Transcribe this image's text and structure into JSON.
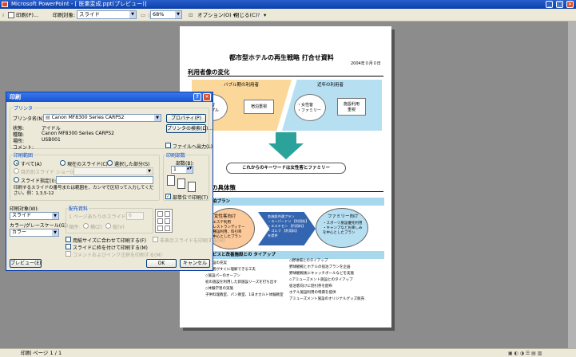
{
  "window": {
    "title": "Microsoft PowerPoint - [ 医業変成.ppt(プレビュー)]",
    "min": "_",
    "max": "□",
    "close": "✕"
  },
  "toolbar": {
    "print": "印刷(P)...",
    "print_target_label": "印刷対象:",
    "print_target_value": "スライド",
    "zoom": "68%",
    "options": "オプション(O) ▾",
    "close_preview": "閉じる(C)",
    "help": "▾"
  },
  "status": {
    "text": "印刷 ページ 1 / 1"
  },
  "slide": {
    "title": "都市型ホテルの再生戦略 打合せ資料",
    "date": "2004年０月０日",
    "section1": "利用者像の変化",
    "bubble_era": "バブル期の利用者",
    "recent_era": "近年の利用者",
    "bubble_users": "・出張客\n・カップル",
    "bubble_purpose": "宿泊重視",
    "recent_users": "・女性客\n・ファミリー",
    "recent_purpose": "施設利用\n重視",
    "keyword": "これからのキーワードは女性客とファミリー",
    "section2": "加のための具体策",
    "band1": "る宿泊プラン",
    "plan_female_title": "女性客向け",
    "plan_female_body": "・エステ利用\n・レストランディナー\n各種設利用、料引率\nを中心としたプラン",
    "plan_common": "各施設共通プラン\n・スーパードリ 【利用料】\n・エステセン 【利用料】\n・ゴルフ 【利用料】\nを提供",
    "plan_family_title": "ファミリー向け",
    "plan_family_body": "・スポーツ施設優先利用\n・キャンプなどお楽しみ\nを中心としたプラン",
    "band2": "サービスと改善施設との タイアップ",
    "list_left": [
      "モン設の充実",
      "利用者がすぐに理解できる工夫",
      "◇施設パーのオープン",
      "初の施設を利用した新施設リーズを打ち出す",
      "◇体験学習の実施",
      "子供料理教室、パン教室、1日オカルト体験教室"
    ],
    "list_right": [
      "◇野球場とのタイアップ",
      "野球観戦とホテルの宿泊プランを企画",
      "野球観戦後にキャッチボールなどを実施",
      "◇アミューズメント施設とのタイアップ",
      "宿泊客向けに割引券を配布",
      "ホテル施設利用の特典を提供",
      "アミューズメント施設のオリジナルグッズ販売"
    ]
  },
  "dialog": {
    "title": "印刷",
    "help": "?",
    "close": "✕",
    "printer_group": "プリンタ",
    "printer_name_label": "プリンタ名(N):",
    "printer_name": "Canon MF8300 Series CARPS2",
    "properties_btn": "プロパティ(P)",
    "find_printer_btn": "プリンタの検索(D)...",
    "status_label": "状態:",
    "status_value": "アイドル",
    "type_label": "種類:",
    "type_value": "Canon MF8300 Series CARPS2",
    "location_label": "場所:",
    "location_value": "USB001",
    "comment_label": "コメント:",
    "print_to_file": "ファイルへ出力(L)",
    "range_group": "印刷範囲",
    "range_all": "すべて(A)",
    "range_current": "現在のスライド(C)",
    "range_selection": "選択した部分(S)",
    "range_custom_show": "目的別スライド ショー(O):",
    "range_slides": "スライド指定(I):",
    "range_help": "印刷するスライドの番号または範囲を、カンマで区切って入力してください。例：1,3,5-12",
    "copies_group": "印刷部数",
    "copies_label": "部数(B):",
    "copies_value": "1",
    "collate": "部単位で印刷(T)",
    "print_what_label": "印刷対象(W):",
    "print_what_value": "スライド",
    "color_label": "カラー/グレースケール(G):",
    "color_value": "カラー",
    "handouts_group": "配布資料",
    "handouts_slides": "1 ページあたりのスライド数(R):",
    "handouts_slides_value": "6",
    "handouts_order": "順序:",
    "handouts_horizontal": "横(Z)",
    "handouts_vertical": "縦(V)",
    "fit_paper": "用紙サイズに合わせて印刷する(F)",
    "frame_slides": "スライドに枠を付けて印刷する(M)",
    "comments": "コメントおよびインク注釈を印刷する(M)",
    "hidden_slides": "非表示スライドを印刷する(H)",
    "preview_btn": "プレビュー(E)",
    "ok_btn": "OK",
    "cancel_btn": "キャンセル"
  }
}
